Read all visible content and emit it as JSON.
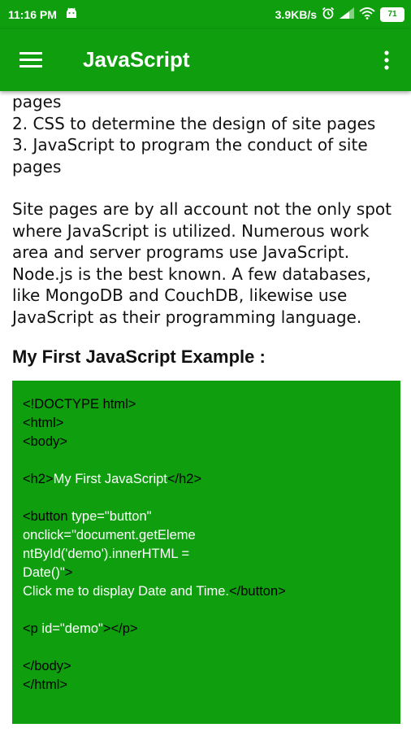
{
  "status_bar": {
    "time": "11:16 PM",
    "speed": "3.9KB/s",
    "battery": "71",
    "icons": [
      "android-icon",
      "alarm-icon",
      "signal-icon",
      "wifi-icon",
      "battery-icon"
    ]
  },
  "app_bar": {
    "title": "JavaScript",
    "menu_icon": "hamburger-menu-icon",
    "overflow_icon": "more-vert-icon"
  },
  "article": {
    "lines": [
      "pages",
      "2. CSS to determine the design of site pages",
      "3. JavaScript to program the conduct of site pages"
    ],
    "paragraph": "Site pages are by all account not the only spot where JavaScript is utilized. Numerous work area and server programs use JavaScript. Node.js is the best known. A few databases, like MongoDB and CouchDB, likewise use JavaScript as their programming language.",
    "example_heading": "My First JavaScript Example :"
  },
  "code_example": {
    "line1": "<!DOCTYPE html>",
    "line2": "<html>",
    "line3": "<body>",
    "h2_open": "<h2>",
    "h2_text": "My First JavaScript",
    "h2_close": "</h2>",
    "button_open": "<button",
    "button_attr1": " type=\"button\"",
    "button_attr2": "onclick=\"document.getEleme",
    "button_attr3": "ntById('demo').innerHTML =",
    "button_attr4": "Date()\"",
    "button_gt": ">",
    "button_text": "Click me to display Date and Time.",
    "button_close": "</button>",
    "p_open": "<p",
    "p_attr": " id=\"demo\"",
    "p_close": "></p>",
    "body_close": "</body>",
    "html_close": "</html>"
  },
  "colors": {
    "primary": "#0e9e0e",
    "code_text_dark": "#000000",
    "code_text_light": "#ffffff"
  }
}
